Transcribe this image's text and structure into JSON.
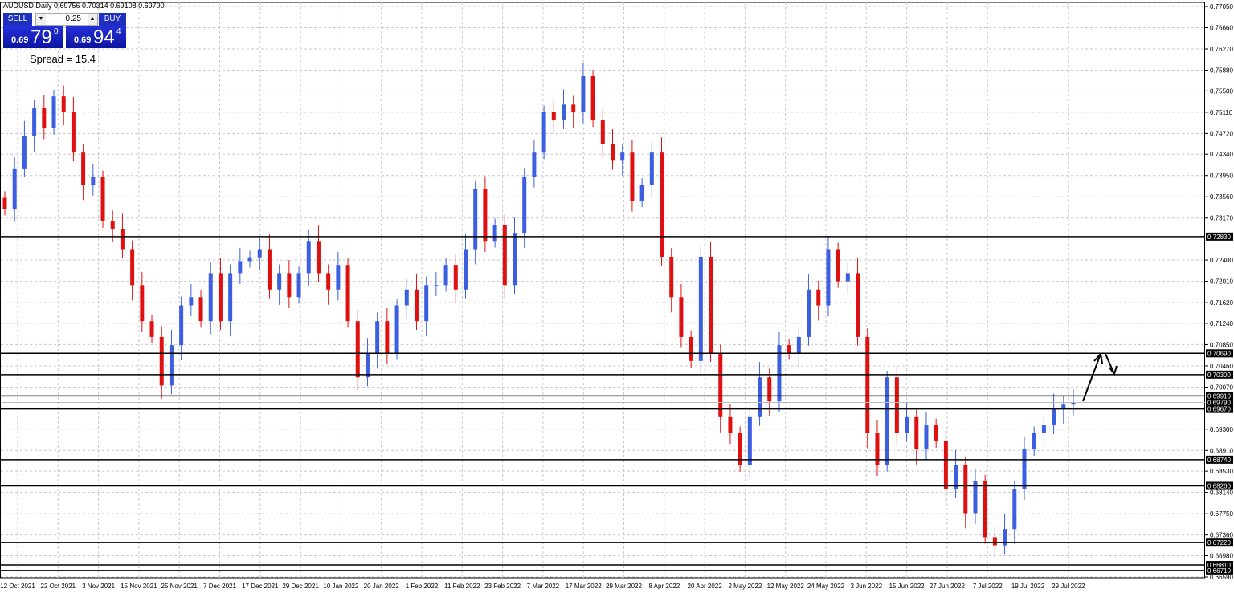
{
  "header": {
    "title": "AUDUSD,Daily  0.69756 0.70314 0.69108 0.69790"
  },
  "trade_panel": {
    "sell_label": "SELL",
    "buy_label": "BUY",
    "lot": "0.25",
    "down": "▼",
    "up": "▲",
    "sell_small": "0.69",
    "sell_big": "79",
    "sell_pip": "0",
    "buy_small": "0.69",
    "buy_big": "94",
    "buy_pip": "4",
    "spread": "Spread = 15.4"
  },
  "chart_data": {
    "type": "candlestick",
    "symbol": "AUDUSD",
    "timeframe": "Daily",
    "ylim": [
      0.6659,
      0.7705
    ],
    "y_ticks": [
      "0.77050",
      "0.76660",
      "0.76270",
      "0.75880",
      "0.75500",
      "0.75110",
      "0.74720",
      "0.74340",
      "0.73950",
      "0.73560",
      "0.73170",
      "0.72400",
      "0.72010",
      "0.71620",
      "0.71240",
      "0.70850",
      "0.70460",
      "0.70070",
      "0.69300",
      "0.68910",
      "0.68530",
      "0.68140",
      "0.67750",
      "0.67360",
      "0.66980",
      "0.66590"
    ],
    "levels": [
      "0.72830",
      "0.70690",
      "0.70300",
      "0.69910",
      "0.69790",
      "0.69670",
      "0.68740",
      "0.68260",
      "0.67220",
      "0.66810",
      "0.66710"
    ],
    "current_price": "0.69790",
    "x_labels": [
      "12 Oct 2021",
      "22 Oct 2021",
      "3 Nov 2021",
      "15 Nov 2021",
      "25 Nov 2021",
      "7 Dec 2021",
      "17 Dec 2021",
      "29 Dec 2021",
      "10 Jan 2022",
      "20 Jan 2022",
      "1 Feb 2022",
      "11 Feb 2022",
      "23 Feb 2022",
      "7 Mar 2022",
      "17 Mar 2022",
      "29 Mar 2022",
      "8 Apr 2022",
      "20 Apr 2022",
      "2 May 2022",
      "12 May 2022",
      "24 May 2022",
      "3 Jun 2022",
      "15 Jun 2022",
      "27 Jun 2022",
      "7 Jul 2022",
      "19 Jul 2022",
      "29 Jul 2022"
    ],
    "close": [
      0.7334,
      0.7408,
      0.7467,
      0.7518,
      0.7482,
      0.754,
      0.7511,
      0.7437,
      0.7378,
      0.7392,
      0.7311,
      0.7297,
      0.726,
      0.7194,
      0.7128,
      0.7099,
      0.701,
      0.7084,
      0.7157,
      0.7172,
      0.7128,
      0.7216,
      0.7128,
      0.7216,
      0.7238,
      0.7245,
      0.726,
      0.7186,
      0.7216,
      0.7172,
      0.7216,
      0.7275,
      0.7216,
      0.7186,
      0.7231,
      0.7128,
      0.7025,
      0.7069,
      0.7128,
      0.7069,
      0.7157,
      0.7186,
      0.7128,
      0.7194,
      0.7194,
      0.7231,
      0.7186,
      0.726,
      0.737,
      0.7275,
      0.7304,
      0.7194,
      0.729,
      0.7393,
      0.7437,
      0.7511,
      0.7496,
      0.7525,
      0.7511,
      0.7577,
      0.7496,
      0.7452,
      0.7422,
      0.7437,
      0.7349,
      0.7378,
      0.7437,
      0.7246,
      0.7172,
      0.7099,
      0.7055,
      0.7246,
      0.7069,
      0.6952,
      0.6923,
      0.6864,
      0.6952,
      0.7025,
      0.6981,
      0.7084,
      0.7069,
      0.7099,
      0.7186,
      0.7157,
      0.726,
      0.7201,
      0.7216,
      0.7099,
      0.6923,
      0.6864,
      0.7025,
      0.6923,
      0.6952,
      0.6893,
      0.6937,
      0.6908,
      0.682,
      0.6864,
      0.6776,
      0.6834,
      0.6732,
      0.6717,
      0.6747,
      0.682,
      0.6893,
      0.6923,
      0.6937,
      0.6967,
      0.6975,
      0.6979
    ],
    "colors": {
      "bull": "#3b5fe0",
      "bear": "#e01010",
      "grid": "#c8c8c8",
      "level": "#000000"
    }
  }
}
